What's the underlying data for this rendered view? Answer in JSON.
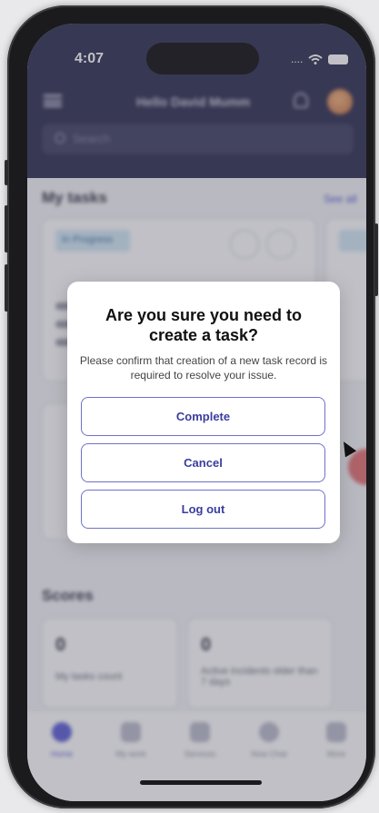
{
  "status_bar": {
    "time": "4:07",
    "carrier_dots": "....",
    "icons": [
      "wifi-icon",
      "battery-icon"
    ]
  },
  "header": {
    "greeting": "Hello David Mumm",
    "search_placeholder": "Search"
  },
  "sections": {
    "my_tasks": "My tasks",
    "see_all": "See all",
    "task_badge": "In Progress",
    "scores": "Scores"
  },
  "scores": [
    {
      "value": "0",
      "label": "My tasks count"
    },
    {
      "value": "0",
      "label": "Active incidents older than 7 days"
    }
  ],
  "tabs": [
    {
      "label": "Home",
      "icon": "home-icon",
      "active": true
    },
    {
      "label": "My work",
      "icon": "briefcase-icon",
      "active": false
    },
    {
      "label": "Services",
      "icon": "grid-icon",
      "active": false
    },
    {
      "label": "Now Chat",
      "icon": "chat-icon",
      "active": false
    },
    {
      "label": "More",
      "icon": "more-icon",
      "active": false
    }
  ],
  "dialog": {
    "title": "Are you sure you need to create a task?",
    "message": "Please confirm that creation of a new task record is required to resolve your issue.",
    "buttons": {
      "complete": "Complete",
      "cancel": "Cancel",
      "logout": "Log out"
    }
  },
  "colors": {
    "header_bg": "#232446",
    "accent": "#5356d4",
    "button_border": "#6f71c9"
  }
}
